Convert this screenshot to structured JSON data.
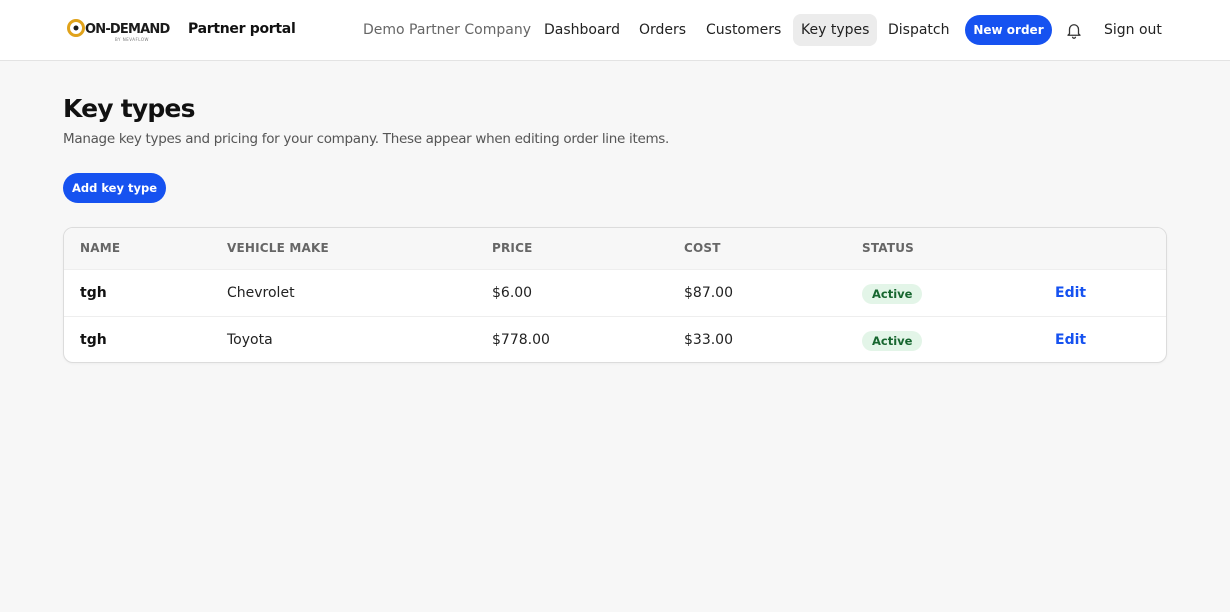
{
  "header": {
    "logo_text": "ON-DEMAND",
    "logo_subtext": "BY NEVAFLOW",
    "portal_label": "Partner portal",
    "company": "Demo Partner Company",
    "nav": [
      "Dashboard",
      "Orders",
      "Customers",
      "Key types",
      "Dispatch"
    ],
    "active_nav": "Key types",
    "new_order_label": "New order",
    "notifications_icon": "bell-icon",
    "sign_out_label": "Sign out"
  },
  "page": {
    "title": "Key types",
    "subtitle": "Manage key types and pricing for your company. These appear when editing order line items.",
    "add_button_label": "Add key type"
  },
  "table": {
    "columns": [
      "NAME",
      "VEHICLE MAKE",
      "PRICE",
      "COST",
      "STATUS"
    ],
    "rows": [
      {
        "name": "tgh",
        "vehicle_make": "Chevrolet",
        "price": "$6.00",
        "cost": "$87.00",
        "status": "Active",
        "action": "Edit"
      },
      {
        "name": "tgh",
        "vehicle_make": "Toyota",
        "price": "$778.00",
        "cost": "$33.00",
        "status": "Active",
        "action": "Edit"
      }
    ]
  },
  "colors": {
    "accent": "#1652f0",
    "active_badge_bg": "#e3f5e8",
    "active_badge_text": "#17662f",
    "page_bg": "#f7f7f7"
  }
}
